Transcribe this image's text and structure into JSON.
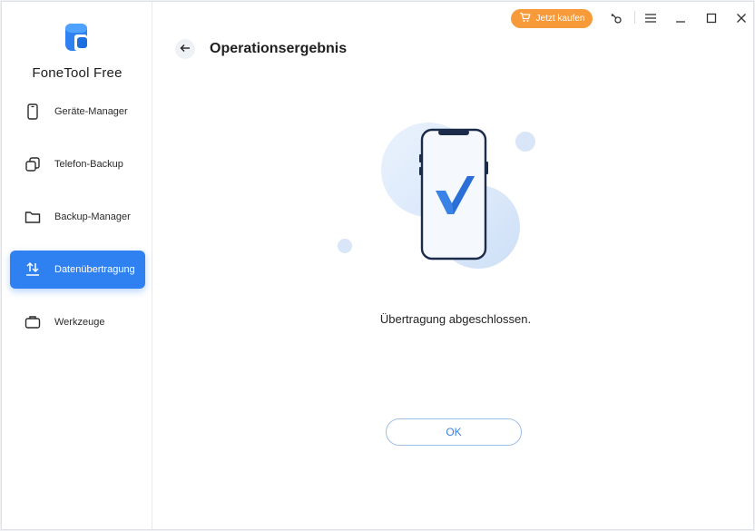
{
  "app": {
    "name": "FoneTool Free"
  },
  "sidebar": {
    "items": [
      {
        "label": "Geräte-Manager",
        "icon": "phone-icon",
        "active": false
      },
      {
        "label": "Telefon-Backup",
        "icon": "copy-icon",
        "active": false
      },
      {
        "label": "Backup-Manager",
        "icon": "folder-icon",
        "active": false
      },
      {
        "label": "Datenübertragung",
        "icon": "transfer-icon",
        "active": true
      },
      {
        "label": "Werkzeuge",
        "icon": "toolbox-icon",
        "active": false
      }
    ]
  },
  "titlebar": {
    "buy_label": "Jetzt kaufen",
    "icons": [
      "key-icon",
      "menu-icon",
      "minimize-icon",
      "maximize-icon",
      "close-icon"
    ]
  },
  "main": {
    "title": "Operationsergebnis",
    "message": "Übertragung abgeschlossen.",
    "ok_label": "OK"
  },
  "colors": {
    "accent": "#2f80f1",
    "buy": "#f79a3a",
    "check": "#3b82e6"
  }
}
